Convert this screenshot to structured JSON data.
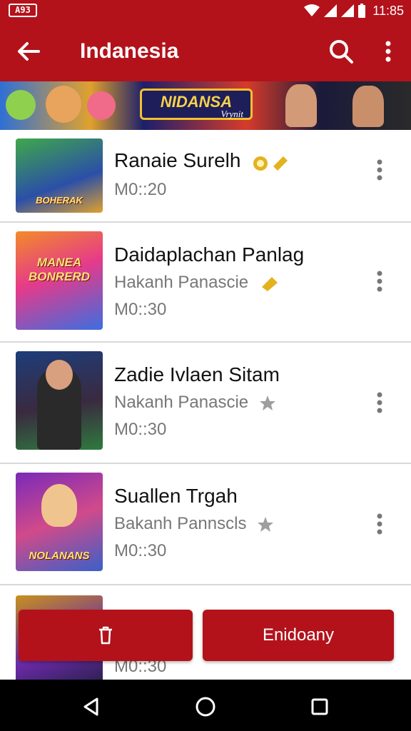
{
  "status_bar": {
    "left_icon_text": "A93",
    "time": "11:85",
    "icons": [
      "wifi-icon",
      "signal-icon",
      "signal-icon",
      "battery-icon"
    ]
  },
  "app_bar": {
    "title": "Indanesia",
    "back_icon": "arrow-back-icon",
    "search_icon": "search-icon",
    "more_icon": "more-vert-icon"
  },
  "banner": {
    "logo_text": "NIDANSA",
    "logo_sub": "Vrynit"
  },
  "list": [
    {
      "title": "Ranaie Surelh",
      "subtitle": "",
      "time": "M0::20",
      "thumb_caption": "BOHERAK",
      "badge": "gold-medal-icon"
    },
    {
      "title": "Daidaplachan Panlag",
      "subtitle": "Hakanh Panascie",
      "time": "M0::30",
      "thumb_caption": "MANEA BONRERD",
      "badge": "gold-medal-icon"
    },
    {
      "title": "Zadie Ivlaen Sitam",
      "subtitle": "Nakanh Panascie",
      "time": "M0::30",
      "thumb_caption": "",
      "badge": "star-icon"
    },
    {
      "title": "Suallen Trgah",
      "subtitle": "Bakanh Pannscls",
      "time": "M0::30",
      "thumb_caption": "NOLANANS",
      "badge": "star-icon"
    },
    {
      "title": "",
      "subtitle": "",
      "time": "M0::30",
      "thumb_caption": "",
      "badge": ""
    }
  ],
  "actions": {
    "delete_icon": "trash-icon",
    "confirm_label": "Enidoany"
  },
  "nav_bar": {
    "icons": [
      "nav-back-icon",
      "nav-home-icon",
      "nav-recent-icon"
    ]
  },
  "colors": {
    "primary": "#b3121b",
    "nav": "#000000",
    "text_secondary": "#777777",
    "badge_gold": "#e3b21e",
    "star_grey": "#9e9e9e"
  }
}
